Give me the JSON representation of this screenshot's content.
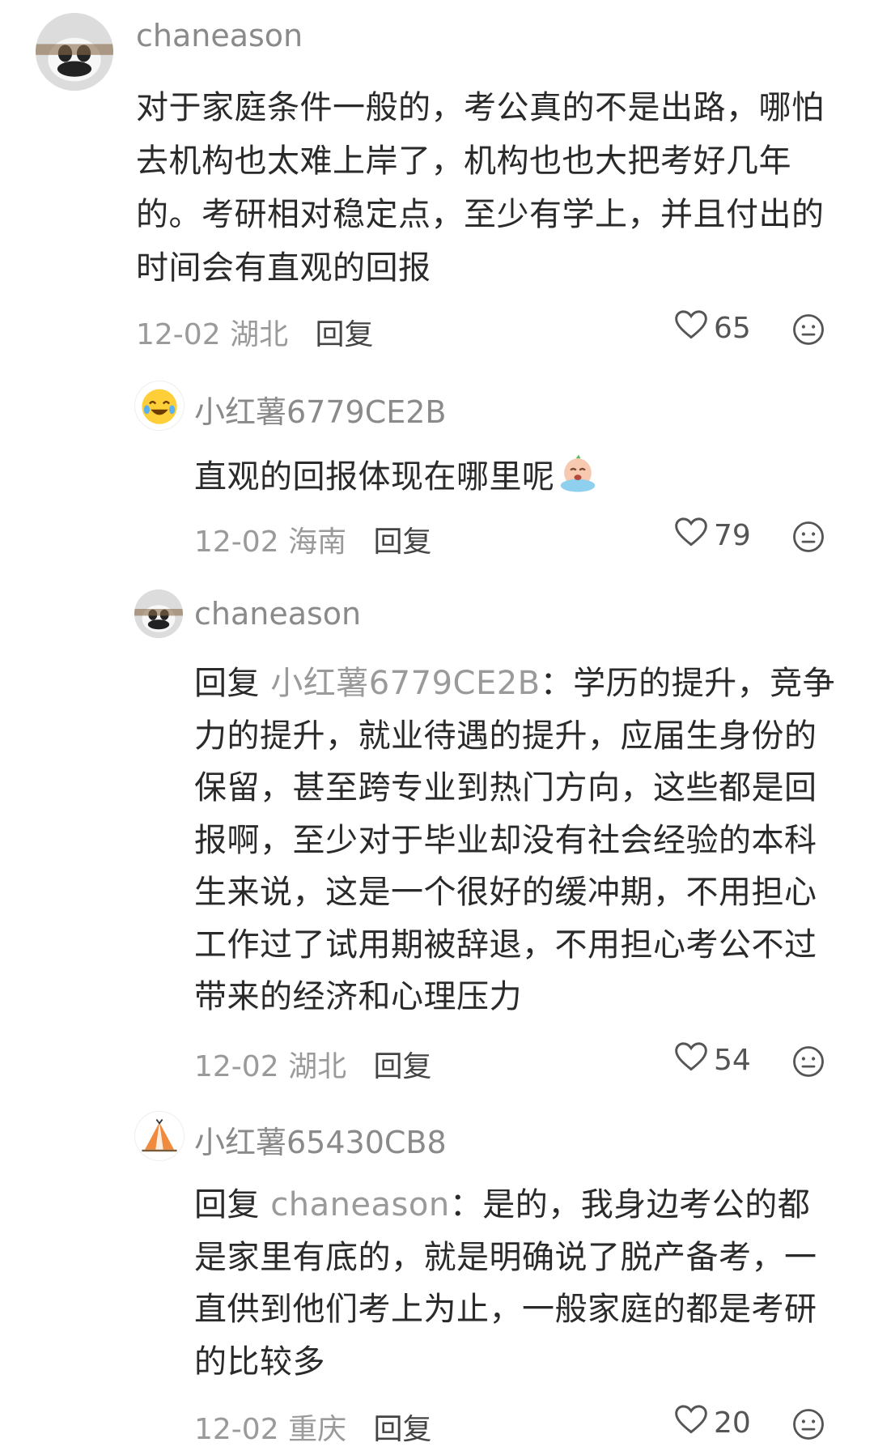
{
  "comments": [
    {
      "username": "chaneason",
      "content": "对于家庭条件一般的，考公真的不是出路，哪怕去机构也太难上岸了，机构也也大把考好几年的。考研相对稳定点，至少有学上，并且付出的时间会有直观的回报",
      "date": "12-02",
      "location": "湖北",
      "reply_label": "回复",
      "likes": "65",
      "avatar_icon": "panda-avatar-icon"
    },
    {
      "username": "小红薯6779CE2B",
      "content": "直观的回报体现在哪里呢",
      "date": "12-02",
      "location": "海南",
      "reply_label": "回复",
      "likes": "79",
      "avatar_icon": "laughing-emoji-avatar-icon"
    },
    {
      "username": "chaneason",
      "reply_word": "回复",
      "reply_target": "小红薯6779CE2B",
      "content": "：学历的提升，竞争力的提升，就业待遇的提升，应届生身份的保留，甚至跨专业到热门方向，这些都是回报啊，至少对于毕业却没有社会经验的本科生来说，这是一个很好的缓冲期，不用担心工作过了试用期被辞退，不用担心考公不过带来的经济和心理压力",
      "date": "12-02",
      "location": "湖北",
      "reply_label": "回复",
      "likes": "54",
      "avatar_icon": "panda-avatar-icon"
    },
    {
      "username": "小红薯65430CB8",
      "reply_word": "回复",
      "reply_target": "chaneason",
      "content": "：是的，我身边考公的都是家里有底的，就是明确说了脱产备考，一直供到他们考上为止，一般家庭的都是考研的比较多",
      "date": "12-02",
      "location": "重庆",
      "reply_label": "回复",
      "likes": "20",
      "avatar_icon": "tent-avatar-icon"
    }
  ],
  "colors": {
    "username": "#8a8a8a",
    "text": "#2a2a2a",
    "meta": "#9a9a9a"
  }
}
